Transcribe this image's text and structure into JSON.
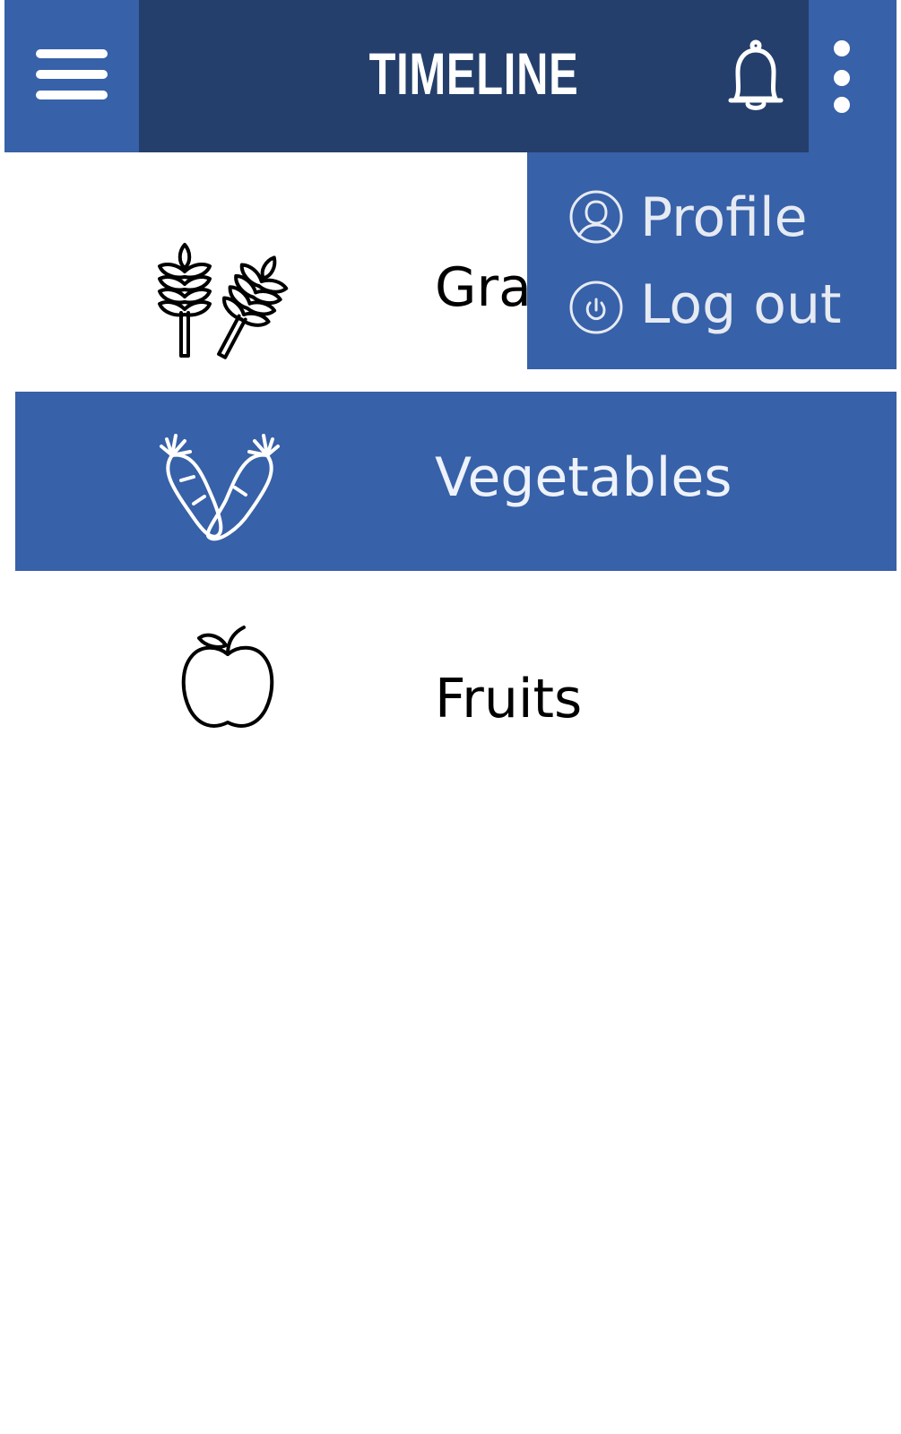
{
  "app_bar": {
    "title": "TIMELINE",
    "menu_icon": "hamburger-menu-icon",
    "notifications_icon": "bell-icon",
    "overflow_icon": "more-vertical-icon"
  },
  "categories": [
    {
      "label": "Grains",
      "icon": "wheat-icon",
      "selected": false
    },
    {
      "label": "Vegetables",
      "icon": "carrot-icon",
      "selected": true
    },
    {
      "label": "Fruits",
      "icon": "apple-icon",
      "selected": false
    }
  ],
  "overflow_menu": {
    "items": [
      {
        "label": "Profile",
        "icon": "user-icon"
      },
      {
        "label": "Log out",
        "icon": "power-icon"
      }
    ]
  },
  "colors": {
    "primary": "#3761a8",
    "title_panel": "#243f6b",
    "background": "#ffffff",
    "menu_text": "#e6eaf3"
  }
}
